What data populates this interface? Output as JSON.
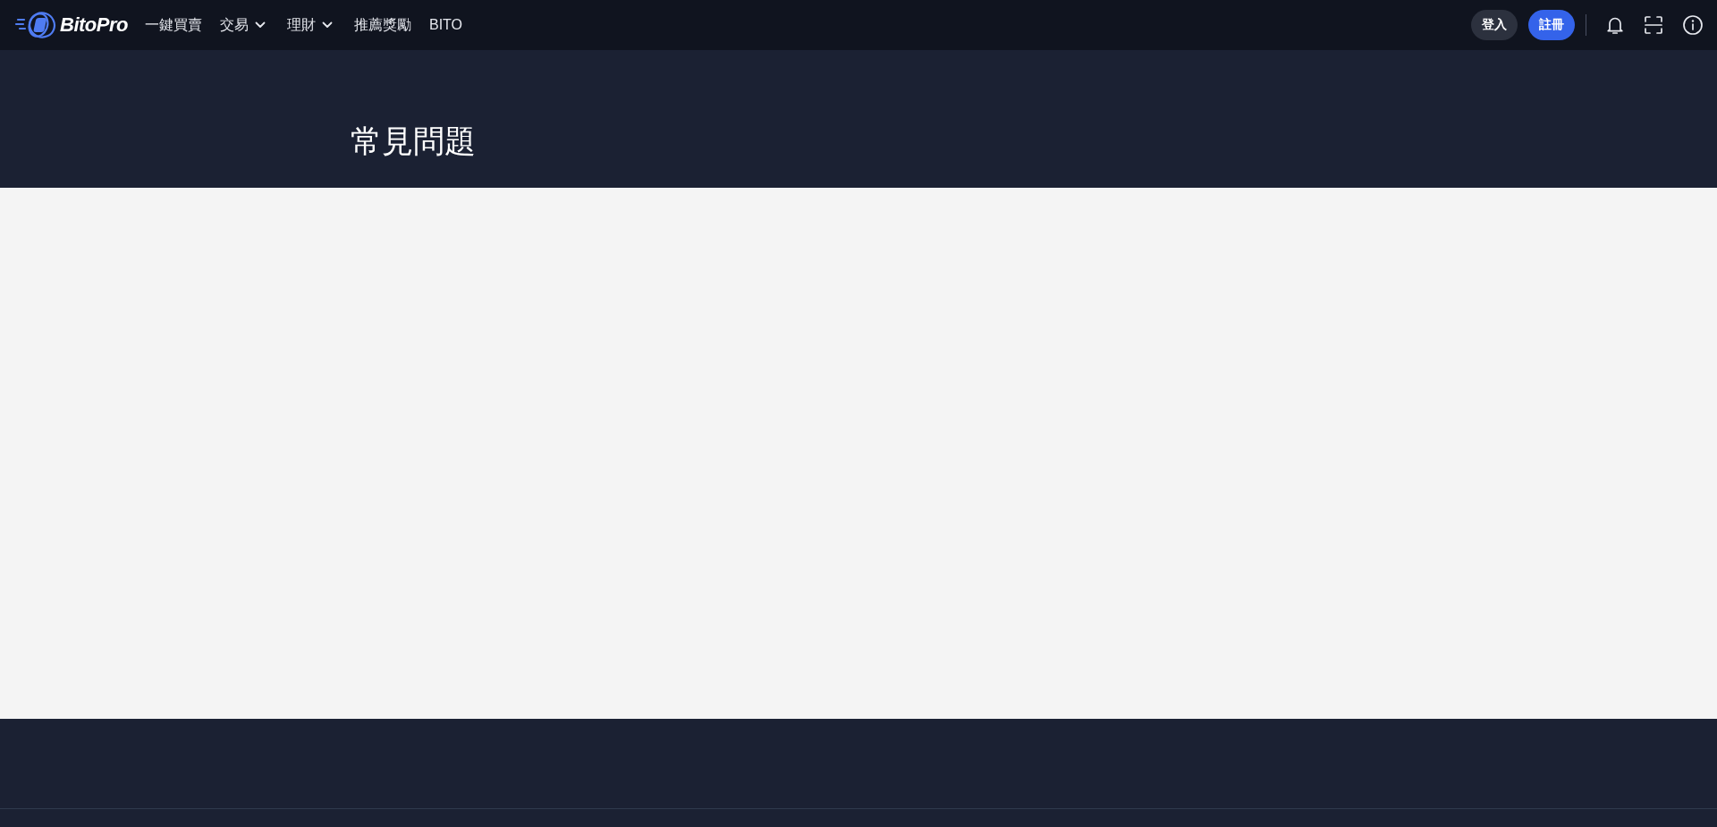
{
  "header": {
    "logo": {
      "text": "BitoPro"
    },
    "nav_items": [
      {
        "label": "一鍵買賣",
        "dropdown": false
      },
      {
        "label": "交易",
        "dropdown": true
      },
      {
        "label": "理財",
        "dropdown": true
      },
      {
        "label": "推薦獎勵",
        "dropdown": false
      },
      {
        "label": "BITO",
        "dropdown": false
      }
    ],
    "buttons": [
      {
        "label": "登入",
        "kind": "secondary"
      },
      {
        "label": "註冊",
        "kind": "primary"
      }
    ]
  },
  "hero": {
    "title": "常見問題"
  }
}
